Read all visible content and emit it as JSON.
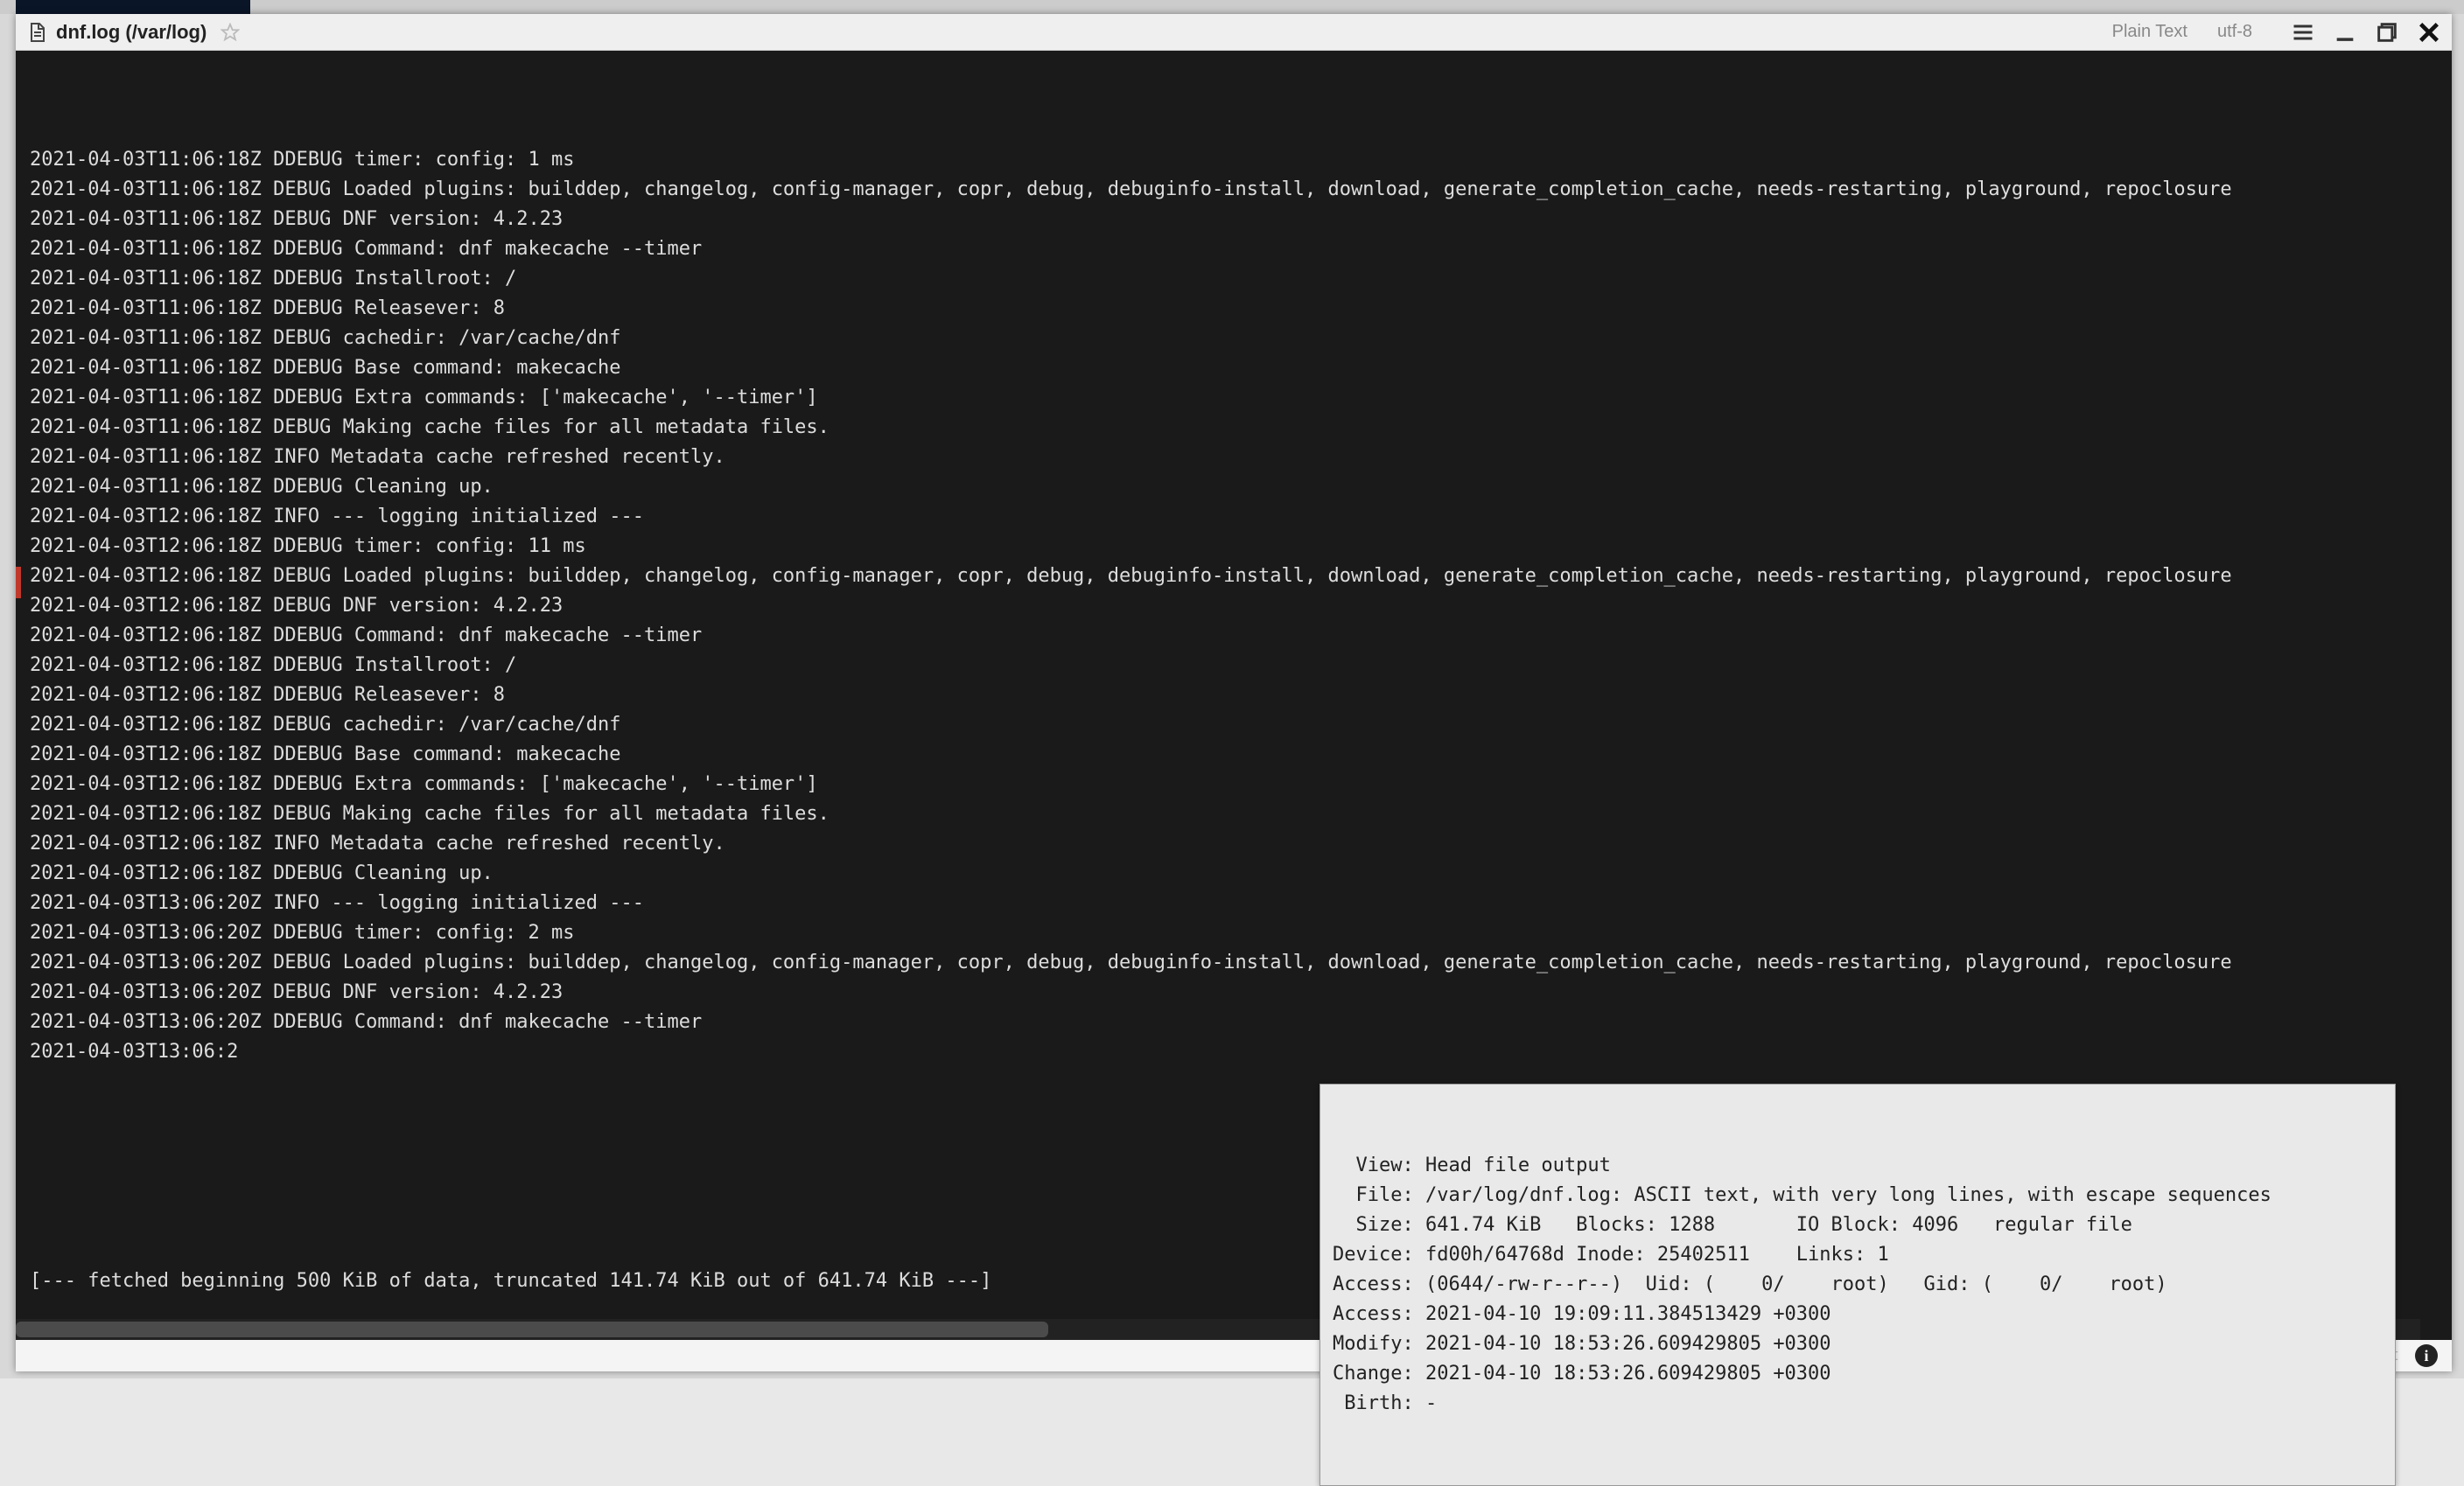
{
  "title": "dnf.log (/var/log)",
  "status": {
    "format": "Plain Text",
    "encoding": "utf-8"
  },
  "log_lines": [
    "2021-04-03T11:06:18Z DDEBUG timer: config: 1 ms",
    "2021-04-03T11:06:18Z DEBUG Loaded plugins: builddep, changelog, config-manager, copr, debug, debuginfo-install, download, generate_completion_cache, needs-restarting, playground, repoclosure",
    "2021-04-03T11:06:18Z DEBUG DNF version: 4.2.23",
    "2021-04-03T11:06:18Z DDEBUG Command: dnf makecache --timer",
    "2021-04-03T11:06:18Z DDEBUG Installroot: /",
    "2021-04-03T11:06:18Z DDEBUG Releasever: 8",
    "2021-04-03T11:06:18Z DEBUG cachedir: /var/cache/dnf",
    "2021-04-03T11:06:18Z DDEBUG Base command: makecache",
    "2021-04-03T11:06:18Z DDEBUG Extra commands: ['makecache', '--timer']",
    "2021-04-03T11:06:18Z DEBUG Making cache files for all metadata files.",
    "2021-04-03T11:06:18Z INFO Metadata cache refreshed recently.",
    "2021-04-03T11:06:18Z DDEBUG Cleaning up.",
    "2021-04-03T12:06:18Z INFO --- logging initialized ---",
    "2021-04-03T12:06:18Z DDEBUG timer: config: 11 ms",
    "2021-04-03T12:06:18Z DEBUG Loaded plugins: builddep, changelog, config-manager, copr, debug, debuginfo-install, download, generate_completion_cache, needs-restarting, playground, repoclosure",
    "2021-04-03T12:06:18Z DEBUG DNF version: 4.2.23",
    "2021-04-03T12:06:18Z DDEBUG Command: dnf makecache --timer",
    "2021-04-03T12:06:18Z DDEBUG Installroot: /",
    "2021-04-03T12:06:18Z DDEBUG Releasever: 8",
    "2021-04-03T12:06:18Z DEBUG cachedir: /var/cache/dnf",
    "2021-04-03T12:06:18Z DDEBUG Base command: makecache",
    "2021-04-03T12:06:18Z DDEBUG Extra commands: ['makecache', '--timer']",
    "2021-04-03T12:06:18Z DEBUG Making cache files for all metadata files.",
    "2021-04-03T12:06:18Z INFO Metadata cache refreshed recently.",
    "2021-04-03T12:06:18Z DDEBUG Cleaning up.",
    "2021-04-03T13:06:20Z INFO --- logging initialized ---",
    "2021-04-03T13:06:20Z DDEBUG timer: config: 2 ms",
    "2021-04-03T13:06:20Z DEBUG Loaded plugins: builddep, changelog, config-manager, copr, debug, debuginfo-install, download, generate_completion_cache, needs-restarting, playground, repoclosure",
    "2021-04-03T13:06:20Z DEBUG DNF version: 4.2.23",
    "2021-04-03T13:06:20Z DDEBUG Command: dnf makecache --timer",
    "2021-04-03T13:06:2"
  ],
  "fetch_note": "[--- fetched beginning 500 KiB of data, truncated 141.74 KiB out of 641.74 KiB ---]",
  "footer": {
    "text": "Head file output"
  },
  "tooltip_lines": [
    "  View: Head file output",
    "  File: /var/log/dnf.log: ASCII text, with very long lines, with escape sequences",
    "  Size: 641.74 KiB   Blocks: 1288       IO Block: 4096   regular file",
    "Device: fd00h/64768d Inode: 25402511    Links: 1",
    "Access: (0644/-rw-r--r--)  Uid: (    0/    root)   Gid: (    0/    root)",
    "Access: 2021-04-10 19:09:11.384513429 +0300",
    "Modify: 2021-04-10 18:53:26.609429805 +0300",
    "Change: 2021-04-10 18:53:26.609429805 +0300",
    " Birth: -"
  ]
}
